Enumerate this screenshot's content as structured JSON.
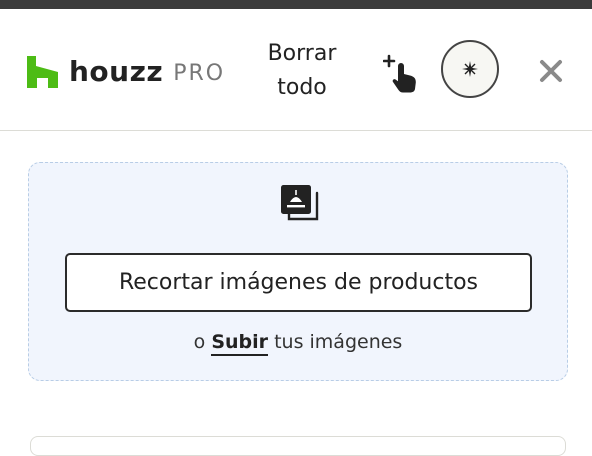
{
  "brand": {
    "name": "houzz",
    "suffix": "PRO",
    "green": "#4dbc15"
  },
  "toolbar": {
    "clear_all_label": "Borrar\ntodo",
    "tap_icon": "tap-plus-icon",
    "sparkle_icon": "sparkle-icon",
    "close_icon": "close-icon"
  },
  "dropzone": {
    "icon": "image-gallery-icon",
    "crop_button_label": "Recortar imágenes de productos",
    "upload_prefix": "o",
    "upload_link": "Subir",
    "upload_suffix": "tus imágenes"
  }
}
